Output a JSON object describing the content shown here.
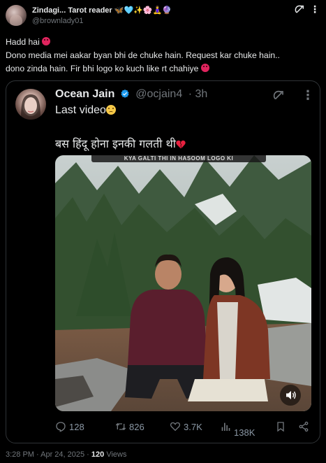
{
  "header": {
    "name": "Zindagi... Tarot reader 🦋🩵✨🌸🧘‍♀️🔮",
    "handle": "@brownlady01"
  },
  "post": {
    "line1": "Hadd hai",
    "line2": "Dono media mei aakar byan bhi de chuke hain. Request kar chuke hain..",
    "line3": "dono zinda hain. Fir bhi logo ko kuch like rt chahiye"
  },
  "quoted": {
    "name": "Ocean Jain",
    "handle": "@ocjain4",
    "time": "· 3h",
    "text1": "Last video",
    "text2": "बस हिंदू होना इनकी गलती थी",
    "video_caption": "KYA GALTI THI IN HASOOM LOGO KI"
  },
  "metrics": {
    "replies": "128",
    "reposts": "826",
    "likes": "3.7K",
    "views": "138K"
  },
  "footer": {
    "datetime": "3:28 PM · Apr 24, 2025 · ",
    "views_count": "120",
    "views_label": " Views"
  },
  "colors": {
    "background": "#000000",
    "text": "#e7e9ea",
    "muted": "#71767b",
    "border": "#2f3336",
    "verified": "#1d9bf0"
  }
}
